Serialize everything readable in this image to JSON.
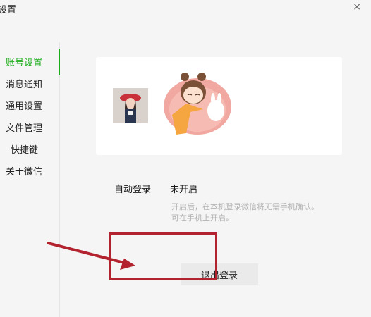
{
  "window": {
    "title": "设置",
    "close_glyph": "×"
  },
  "sidebar": {
    "items": [
      {
        "label": "账号设置",
        "active": true
      },
      {
        "label": "消息通知",
        "active": false
      },
      {
        "label": "通用设置",
        "active": false
      },
      {
        "label": "文件管理",
        "active": false
      },
      {
        "label": "快捷键",
        "active": false
      },
      {
        "label": "关于微信",
        "active": false
      }
    ]
  },
  "account": {
    "auto_login_label": "自动登录",
    "auto_login_value": "未开启",
    "hint_line1": "开启后，在本机登录微信将无需手机确认。",
    "hint_line2": "可在手机上开启。",
    "logout_button": "退出登录"
  },
  "colors": {
    "accent": "#1aad19",
    "annotation": "#b3222f"
  }
}
